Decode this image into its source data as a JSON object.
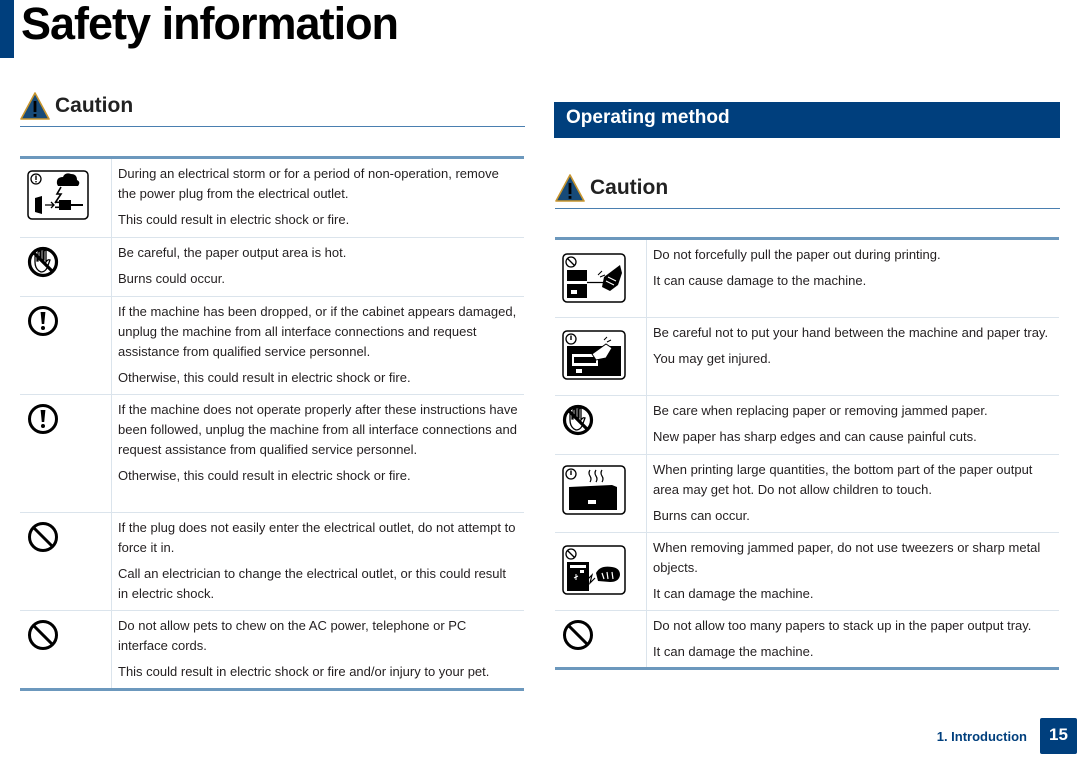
{
  "page": {
    "title": "Safety information"
  },
  "left": {
    "caution_label": "Caution",
    "rows": [
      {
        "icon": "storm-unplug-icon",
        "lines": [
          "During an electrical storm or for a period of non-operation, remove the power plug from the electrical outlet.",
          "This could result in electric shock or fire."
        ]
      },
      {
        "icon": "no-touch-hot-icon",
        "lines": [
          "Be careful, the paper output area is hot.",
          "Burns could occur."
        ]
      },
      {
        "icon": "caution-mandatory-icon",
        "lines": [
          "If the machine has been dropped, or if the cabinet appears damaged, unplug the machine from all interface connections and request assistance from qualified service personnel.",
          "Otherwise, this could result in electric shock or fire."
        ]
      },
      {
        "icon": "caution-mandatory-icon",
        "lines": [
          "If the machine does not operate properly after these instructions have been followed, unplug the machine from all interface connections and request assistance from qualified service personnel.",
          "Otherwise, this could result in electric shock or fire."
        ]
      },
      {
        "icon": "prohibited-icon",
        "lines": [
          "If the plug does not easily enter the electrical outlet, do not attempt to force it in.",
          "Call an electrician to change the electrical outlet, or this could result in electric shock."
        ]
      },
      {
        "icon": "prohibited-icon",
        "lines": [
          "Do not allow pets to chew on the AC power, telephone or PC interface cords.",
          "This could result in electric shock or fire and/or injury to your pet."
        ]
      }
    ]
  },
  "right": {
    "section_title": "Operating method",
    "caution_label": "Caution",
    "rows": [
      {
        "icon": "no-pull-paper-icon",
        "lines": [
          "Do not forcefully pull the paper out during printing.",
          "It can cause damage to the machine."
        ]
      },
      {
        "icon": "hand-in-tray-icon",
        "lines": [
          "Be careful not to put your hand between the machine and paper tray.",
          "You may get injured."
        ]
      },
      {
        "icon": "no-touch-hand-icon",
        "lines": [
          "Be care when replacing paper or removing jammed paper.",
          "New paper has sharp edges and can cause painful cuts."
        ]
      },
      {
        "icon": "hot-output-icon",
        "lines": [
          "When printing large quantities, the bottom part of the paper output area may get hot. Do not allow children to touch.",
          "Burns can occur."
        ]
      },
      {
        "icon": "no-tweezers-icon",
        "lines": [
          "When removing jammed paper, do not use tweezers or sharp metal objects.",
          "It can damage the machine."
        ]
      },
      {
        "icon": "prohibited-icon",
        "lines": [
          "Do not allow too many papers to stack up in the paper output tray.",
          "It can damage the machine."
        ]
      }
    ]
  },
  "footer": {
    "chapter": "1. Introduction",
    "page_number": "15"
  },
  "colors": {
    "brand_blue": "#003f7d",
    "table_rule": "#6c98bd"
  }
}
